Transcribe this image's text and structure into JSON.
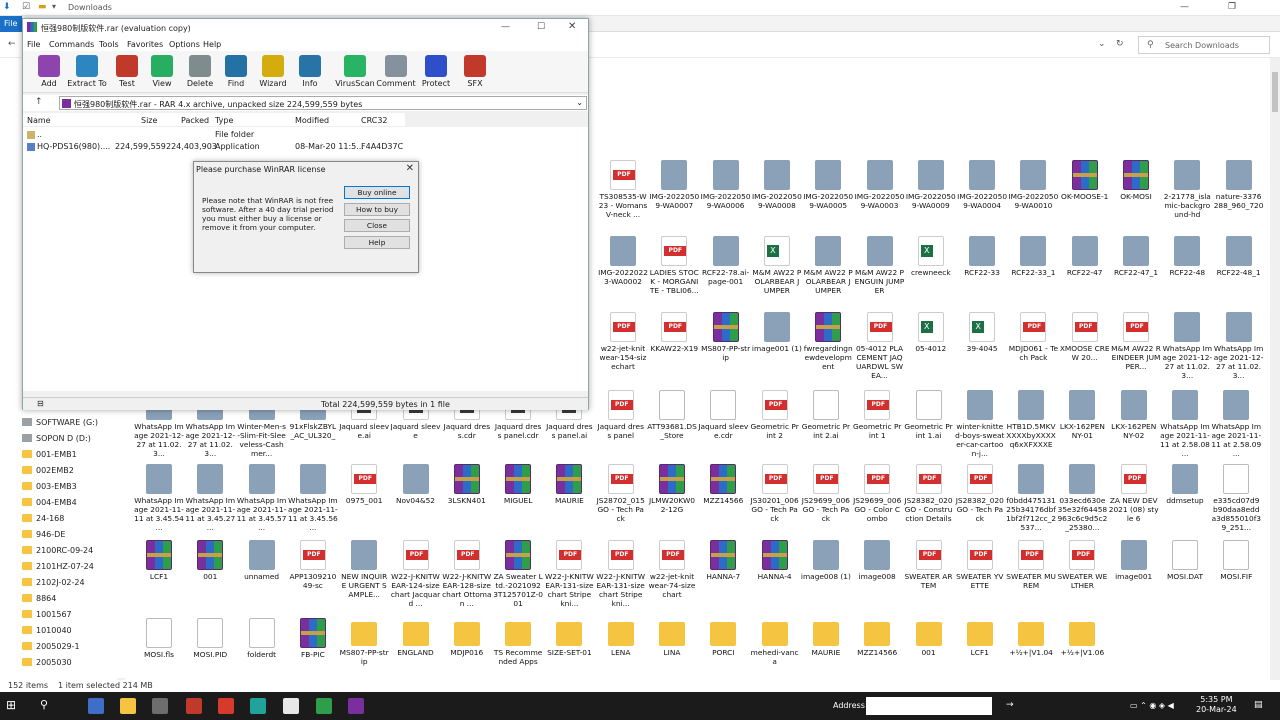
{
  "explorer": {
    "title": "Downloads",
    "file_tab": "File",
    "search_placeholder": "Search Downloads",
    "status_count": "152 items",
    "status_selected": "1 item selected  214 MB",
    "nav": [
      {
        "label": "SOFTWARE (G:)",
        "kind": "drive"
      },
      {
        "label": "SOPON D (D:)",
        "kind": "drive"
      },
      {
        "label": "001-EMB1",
        "kind": "folder"
      },
      {
        "label": "002EMB2",
        "kind": "folder"
      },
      {
        "label": "003-EMB3",
        "kind": "folder"
      },
      {
        "label": "004-EMB4",
        "kind": "folder"
      },
      {
        "label": "24-168",
        "kind": "folder"
      },
      {
        "label": "946-DE",
        "kind": "folder"
      },
      {
        "label": "2100RC-09-24",
        "kind": "folder"
      },
      {
        "label": "2101HZ-07-24",
        "kind": "folder"
      },
      {
        "label": "2102J-02-24",
        "kind": "folder"
      },
      {
        "label": "8864",
        "kind": "folder"
      },
      {
        "label": "1001567",
        "kind": "folder"
      },
      {
        "label": "1010040",
        "kind": "folder"
      },
      {
        "label": "2005029-1",
        "kind": "folder"
      },
      {
        "label": "2005030",
        "kind": "folder"
      }
    ],
    "rows": [
      {
        "items": [
          {
            "n": "TS308535-W23 - Womans V-neck ...",
            "t": "pdf"
          },
          {
            "n": "IMG-20220509-WA0007",
            "t": "img"
          },
          {
            "n": "IMG-20220509-WA0006",
            "t": "img"
          },
          {
            "n": "IMG-20220509-WA0008",
            "t": "img"
          },
          {
            "n": "IMG-20220509-WA0005",
            "t": "img"
          },
          {
            "n": "IMG-20220509-WA0003",
            "t": "img"
          },
          {
            "n": "IMG-20220509-WA0009",
            "t": "img"
          },
          {
            "n": "IMG-20220509-WA0004",
            "t": "img"
          },
          {
            "n": "IMG-20220509-WA0010",
            "t": "img"
          },
          {
            "n": "OK-MOOSE-1",
            "t": "rar"
          },
          {
            "n": "OK-MOSI",
            "t": "rar"
          },
          {
            "n": "2-21778_islamic-background-hd",
            "t": "img"
          },
          {
            "n": "nature-3376288_960_720",
            "t": "img"
          }
        ]
      },
      {
        "items": [
          {
            "n": "IMG-20220223-WA0002",
            "t": "img"
          },
          {
            "n": "LADIES STOCK - MORGANITE - TBLI06...",
            "t": "pdf"
          },
          {
            "n": "RCF22-78.ai-page-001",
            "t": "img"
          },
          {
            "n": "M&M AW22 POLARBEAR JUMPER",
            "t": "xls"
          },
          {
            "n": "M&M AW22 POLARBEAR JUMPER",
            "t": "img"
          },
          {
            "n": "M&M AW22 PENGUIN JUMPER",
            "t": "img"
          },
          {
            "n": "crewneeck",
            "t": "xls"
          },
          {
            "n": "RCF22-33",
            "t": "img"
          },
          {
            "n": "RCF22-33_1",
            "t": "img"
          },
          {
            "n": "RCF22-47",
            "t": "img"
          },
          {
            "n": "RCF22-47_1",
            "t": "img"
          },
          {
            "n": "RCF22-48",
            "t": "img"
          },
          {
            "n": "RCF22-48_1",
            "t": "img"
          }
        ]
      },
      {
        "items": [
          {
            "n": "w22-jet-knitwear-154-sizechart",
            "t": "pdf"
          },
          {
            "n": "KKAW22-X19",
            "t": "pdf"
          },
          {
            "n": "MS807-PP-strip",
            "t": "rar"
          },
          {
            "n": "image001 (1)",
            "t": "img"
          },
          {
            "n": "fwregardingnewdevelopment",
            "t": "rar"
          },
          {
            "n": "05-4012 PLACEMENT JAQUARDWL SWEA...",
            "t": "pdf"
          },
          {
            "n": "05-4012",
            "t": "xls"
          },
          {
            "n": "39-4045",
            "t": "xls"
          },
          {
            "n": "MDJD061 - Tech Pack",
            "t": "pdf"
          },
          {
            "n": "XMOOSE CREW 20...",
            "t": "pdf"
          },
          {
            "n": "M&M AW22 REINDEER JUMPER...",
            "t": "pdf"
          },
          {
            "n": "WhatsApp Image 2021-12-27 at 11.02.3...",
            "t": "img"
          },
          {
            "n": "WhatsApp Image 2021-12-27 at 11.02.3...",
            "t": "img"
          }
        ]
      },
      {
        "items": [
          {
            "n": "WhatsApp Image 2021-12-27 at 11.02.3...",
            "t": "img"
          },
          {
            "n": "WhatsApp Image 2021-12-27 at 11.02.3...",
            "t": "img"
          },
          {
            "n": "Winter-Men-s-Slim-Fit-Sleeveless-Cashmer...",
            "t": "img"
          },
          {
            "n": "91xFlskZBYL_AC_UL320_",
            "t": "img"
          },
          {
            "n": "Jaquard sleeve.ai",
            "t": "ai"
          },
          {
            "n": "Jaquard sleeve",
            "t": "ai"
          },
          {
            "n": "Jaquard dress.cdr",
            "t": "ai"
          },
          {
            "n": "Jaquard dress panel.cdr",
            "t": "ai"
          },
          {
            "n": "Jaquard dress panel.ai",
            "t": "ai"
          },
          {
            "n": "Jaquard dress panel",
            "t": "pdf"
          },
          {
            "n": "ATT93681.DS_Store",
            "t": "doc"
          },
          {
            "n": "Jaquard sleeve.cdr",
            "t": "doc"
          },
          {
            "n": "Geometric Print 2",
            "t": "pdf"
          },
          {
            "n": "Geometric Print 2.ai",
            "t": "doc"
          },
          {
            "n": "Geometric Print 1",
            "t": "pdf"
          },
          {
            "n": "Geometric Print 1.ai",
            "t": "doc"
          },
          {
            "n": "winter-knitted-boys-sweater-car-cartoon-j...",
            "t": "img"
          },
          {
            "n": "HTB1D.5MKVXXXXbyXXXXq6xXFXXXE",
            "t": "img"
          },
          {
            "n": "LKX-162PENNY-01",
            "t": "img"
          },
          {
            "n": "LKX-162PENNY-02",
            "t": "img"
          },
          {
            "n": "WhatsApp Image 2021-11-11 at 2.58.08 ...",
            "t": "img"
          },
          {
            "n": "WhatsApp Image 2021-11-11 at 2.58.09 ...",
            "t": "img"
          }
        ]
      },
      {
        "items": [
          {
            "n": "WhatsApp Image 2021-11-11 at 3.45.54 ...",
            "t": "img"
          },
          {
            "n": "WhatsApp Image 2021-11-11 at 3.45.27 ...",
            "t": "img"
          },
          {
            "n": "WhatsApp Image 2021-11-11 at 3.45.57 ...",
            "t": "img"
          },
          {
            "n": "WhatsApp Image 2021-11-11 at 3.45.56 ...",
            "t": "img"
          },
          {
            "n": "0975_001",
            "t": "pdf"
          },
          {
            "n": "Nov04&52",
            "t": "img"
          },
          {
            "n": "3LSKN401",
            "t": "rar"
          },
          {
            "n": "MIGUEL",
            "t": "rar"
          },
          {
            "n": "MAURIE",
            "t": "rar"
          },
          {
            "n": "JS28702_015GO - Tech Pack",
            "t": "pdf"
          },
          {
            "n": "JLMW20KW02-12G",
            "t": "rar"
          },
          {
            "n": "MZZ14566",
            "t": "rar"
          },
          {
            "n": "JS30201_006GO - Tech Pack",
            "t": "pdf"
          },
          {
            "n": "JS29699_006GO - Tech Pack",
            "t": "pdf"
          },
          {
            "n": "JS29699_006GO - Color Combo",
            "t": "pdf"
          },
          {
            "n": "JS28382_020GO - Construction Details",
            "t": "pdf"
          },
          {
            "n": "JS28382_020GO - Tech Pack",
            "t": "pdf"
          },
          {
            "n": "f0bdd47513125b34176dbf1bf2f712cc_2537...",
            "t": "img"
          },
          {
            "n": "033ecd630e35e32f64458963c6c9d5c2_25380...",
            "t": "img"
          },
          {
            "n": "ZA NEW DEV 2021 (08) style 6",
            "t": "pdf"
          },
          {
            "n": "ddmsetup",
            "t": "img"
          },
          {
            "n": "e335cd07d9b90daa8edda3d855010f39_251...",
            "t": "doc"
          }
        ]
      },
      {
        "items": [
          {
            "n": "LCF1",
            "t": "rar"
          },
          {
            "n": "001",
            "t": "rar"
          },
          {
            "n": "unnamed",
            "t": "img"
          },
          {
            "n": "APP130921049-sc",
            "t": "pdf"
          },
          {
            "n": "NEW INQUIRE URGENT SAMPLE...",
            "t": "img"
          },
          {
            "n": "W22-J-KNITWEAR-124-sizechart Jacquard ...",
            "t": "pdf"
          },
          {
            "n": "W22-J-KNITWEAR-128-sizechart Ottoman ...",
            "t": "pdf"
          },
          {
            "n": "ZA Sweater Ltd.-20210923T125701Z-001",
            "t": "rar"
          },
          {
            "n": "W22-J-KNITWEAR-131-sizechart Stripe kni...",
            "t": "pdf"
          },
          {
            "n": "W22-J-KNITWEAR-131-sizechart Stripe kni...",
            "t": "pdf"
          },
          {
            "n": "w22-jet-knitwear-74-sizechart",
            "t": "pdf"
          },
          {
            "n": "HANNA-7",
            "t": "rar"
          },
          {
            "n": "HANNA-4",
            "t": "rar"
          },
          {
            "n": "image008 (1)",
            "t": "img"
          },
          {
            "n": "image008",
            "t": "img"
          },
          {
            "n": "SWEATER ARTEM",
            "t": "pdf"
          },
          {
            "n": "SWEATER YVETTE",
            "t": "pdf"
          },
          {
            "n": "SWEATER MUREM",
            "t": "pdf"
          },
          {
            "n": "SWEATER WELTHER",
            "t": "pdf"
          },
          {
            "n": "image001",
            "t": "img"
          },
          {
            "n": "MOSI.DAT",
            "t": "doc"
          },
          {
            "n": "MOSI.FIF",
            "t": "doc"
          }
        ]
      },
      {
        "items": [
          {
            "n": "MOSI.fls",
            "t": "doc"
          },
          {
            "n": "MOSI.PID",
            "t": "doc"
          },
          {
            "n": "folderdt",
            "t": "doc"
          },
          {
            "n": "FB-PIC",
            "t": "rar"
          },
          {
            "n": "MS807-PP-strip",
            "t": "folder"
          },
          {
            "n": "ENGLAND",
            "t": "folder"
          },
          {
            "n": "MDJP016",
            "t": "folder"
          },
          {
            "n": "TS Recommended Apps",
            "t": "folder"
          },
          {
            "n": "SIZE-SET-01",
            "t": "folder"
          },
          {
            "n": "LENA",
            "t": "folder"
          },
          {
            "n": "LINA",
            "t": "folder"
          },
          {
            "n": "PORCI",
            "t": "folder"
          },
          {
            "n": "mehedi-vanca",
            "t": "folder"
          },
          {
            "n": "MAURIE",
            "t": "folder"
          },
          {
            "n": "MZZ14566",
            "t": "folder"
          },
          {
            "n": "001",
            "t": "folder"
          },
          {
            "n": "LCF1",
            "t": "folder"
          },
          {
            "n": "+½+|V1.04",
            "t": "folder"
          },
          {
            "n": "+½+|V1.06",
            "t": "folder"
          }
        ]
      }
    ]
  },
  "winrar": {
    "title": "恒强980制版软件.rar (evaluation copy)",
    "menu": [
      "File",
      "Commands",
      "Tools",
      "Favorites",
      "Options",
      "Help"
    ],
    "toolbar": [
      {
        "label": "Add",
        "color": "#8e44ad"
      },
      {
        "label": "Extract To",
        "color": "#2e86c1"
      },
      {
        "label": "Test",
        "color": "#c0392b"
      },
      {
        "label": "View",
        "color": "#27ae60"
      },
      {
        "label": "Delete",
        "color": "#7f8c8d"
      },
      {
        "label": "Find",
        "color": "#2471a3"
      },
      {
        "label": "Wizard",
        "color": "#d4ac0d"
      },
      {
        "label": "Info",
        "color": "#2874a6"
      },
      {
        "label": "VirusScan",
        "color": "#28b463"
      },
      {
        "label": "Comment",
        "color": "#85929e"
      },
      {
        "label": "Protect",
        "color": "#2e4fc9"
      },
      {
        "label": "SFX",
        "color": "#c0392b"
      }
    ],
    "path": "恒强980制版软件.rar - RAR 4.x archive, unpacked size 224,599,559 bytes",
    "columns": [
      "Name",
      "Size",
      "Packed",
      "Type",
      "Modified",
      "CRC32"
    ],
    "files": [
      {
        "name": "..",
        "size": "",
        "packed": "",
        "type": "File folder",
        "modified": "",
        "crc": ""
      },
      {
        "name": "HQ-PDS16(980)....",
        "size": "224,599,559",
        "packed": "224,403,903",
        "type": "Application",
        "modified": "08-Mar-20 11:5...",
        "crc": "F4A4D37C"
      }
    ],
    "status": "Total 224,599,559 bytes in 1 file"
  },
  "dialog": {
    "title": "Please purchase WinRAR license",
    "text": "Please note that WinRAR is not free software. After a 40 day trial period you must either buy a license or remove it from your computer.",
    "buttons": [
      "Buy online",
      "How to buy",
      "Close",
      "Help"
    ]
  },
  "taskbar": {
    "address_label": "Address",
    "time": "5:35 PM",
    "date": "20-Mar-24",
    "apps": [
      {
        "name": "start-icon",
        "color": "#1b1b1b"
      },
      {
        "name": "search-icon",
        "color": "#1b1b1b"
      },
      {
        "name": "mail-icon",
        "color": "#3f6ec7"
      },
      {
        "name": "file-explorer-icon",
        "color": "#f5c542"
      },
      {
        "name": "calculator-icon",
        "color": "#6d6d6d"
      },
      {
        "name": "app-red-icon",
        "color": "#c0392b"
      },
      {
        "name": "app-r-icon",
        "color": "#d63a2a"
      },
      {
        "name": "app-teal-icon",
        "color": "#1fa39a"
      },
      {
        "name": "app-notes-icon",
        "color": "#e8e8e8"
      },
      {
        "name": "app-chart-icon",
        "color": "#2f9e4a"
      },
      {
        "name": "winrar-icon",
        "color": "#7b2f9e"
      }
    ]
  }
}
